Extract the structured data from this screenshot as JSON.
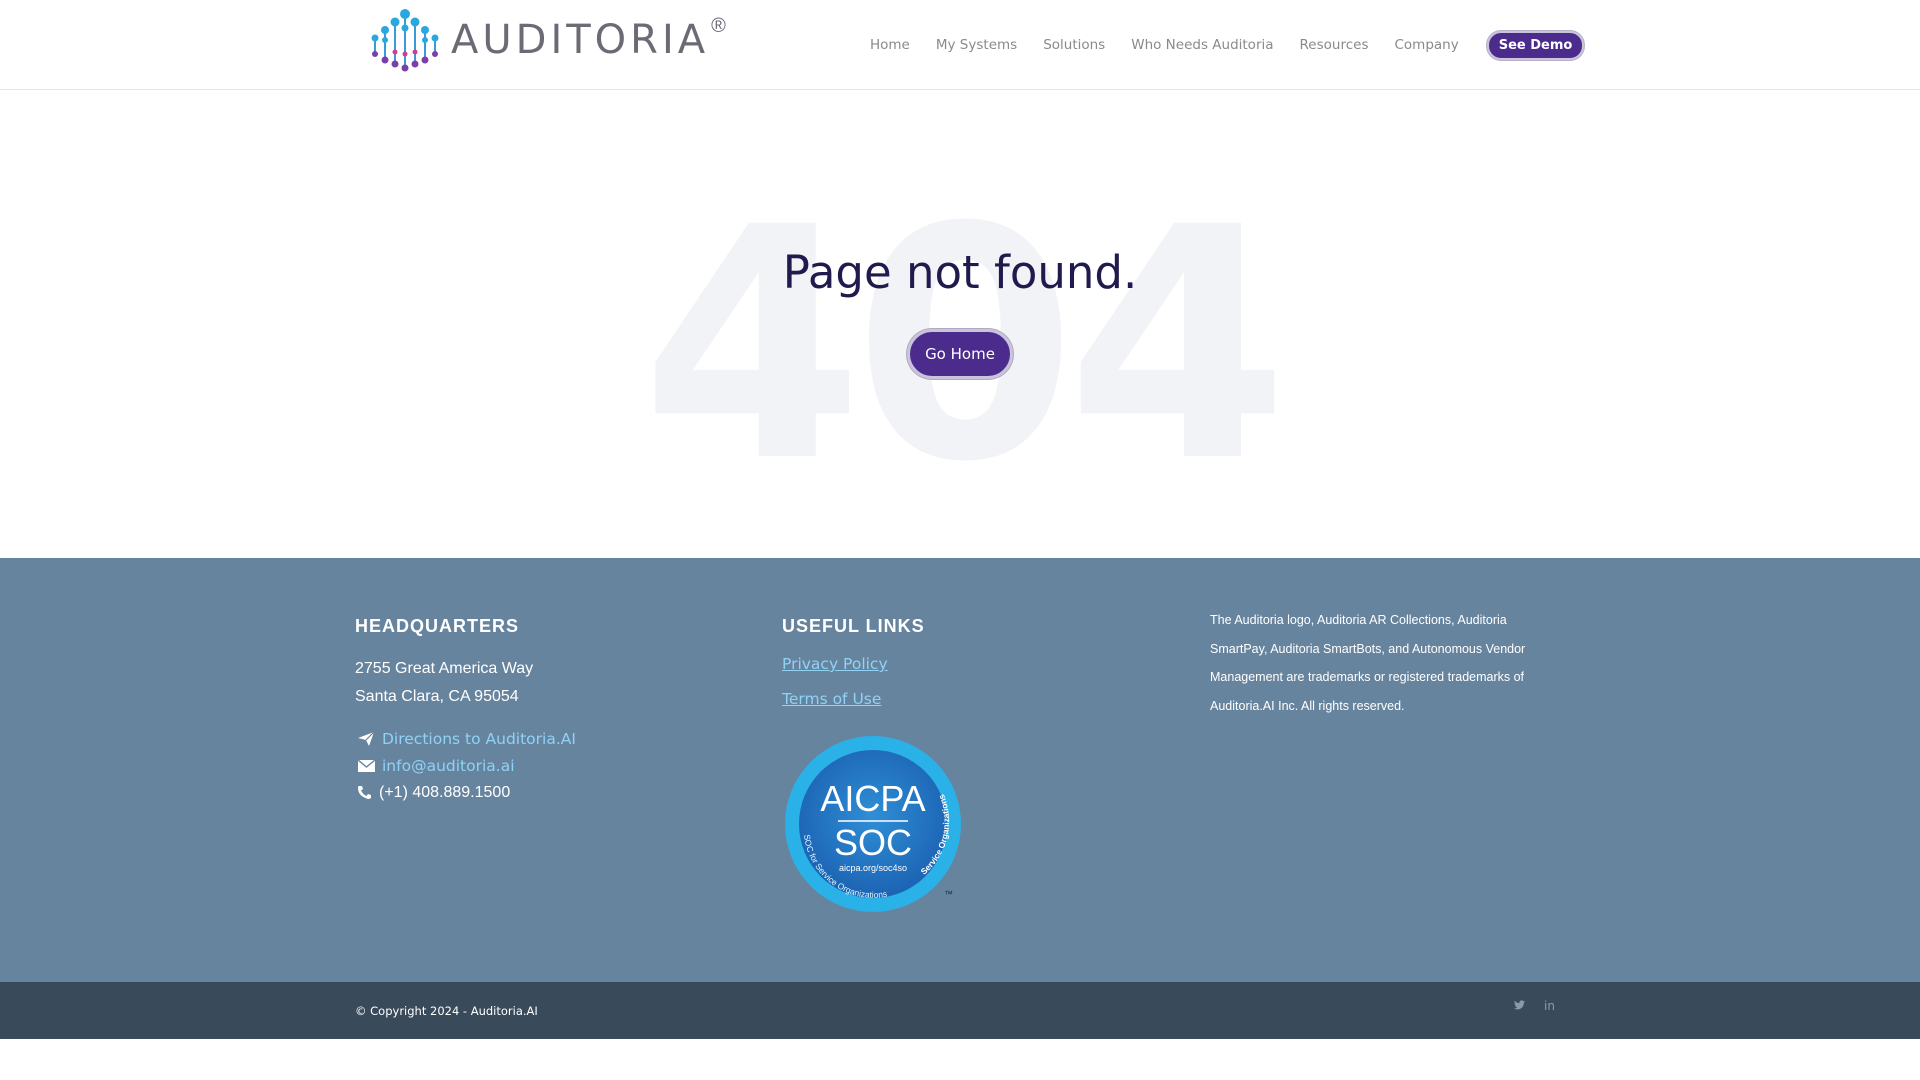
{
  "header": {
    "logo_text": "AUDITORIA",
    "logo_mark": "®",
    "nav": [
      "Home",
      "My Systems",
      "Solutions",
      "Who Needs Auditoria",
      "Resources",
      "Company"
    ],
    "demo_label": "See Demo"
  },
  "main": {
    "bg_text": "404",
    "title": "Page not found.",
    "go_home_label": "Go Home"
  },
  "footer": {
    "hq_title": "HEADQUARTERS",
    "address_line1": "2755 Great America Way",
    "address_line2": "Santa Clara, CA 95054",
    "directions": "Directions to Auditoria.AI",
    "email": "info@auditoria.ai",
    "phone": "(+1) 408.889.1500",
    "links_title": "USEFUL LINKS",
    "privacy": "Privacy Policy",
    "terms": "Terms of Use",
    "legal": "The Auditoria logo, Auditoria AR Collections, Auditoria SmartPay, Auditoria SmartBots, and Autonomous Vendor Management are trademarks or registered trademarks of Auditoria.AI Inc. All rights reserved.",
    "badge": {
      "line1": "AICPA",
      "line2": "SOC",
      "url": "aicpa.org/soc4so",
      "ring_left": "SOC for Service Organizations",
      "ring_right": "Service Organizations",
      "tm": "™"
    }
  },
  "bottom": {
    "copyright": "© Copyright 2024 - Auditoria.AI",
    "twitter_icon": "twitter-icon",
    "linkedin_icon": "linkedin-icon",
    "linkedin_glyph": "in"
  },
  "colors": {
    "accent": "#4b2c8c",
    "footer_bg": "#67849f",
    "bottom_bg": "#394a5b",
    "link": "#8fd2f5",
    "title": "#1f1b4d"
  }
}
